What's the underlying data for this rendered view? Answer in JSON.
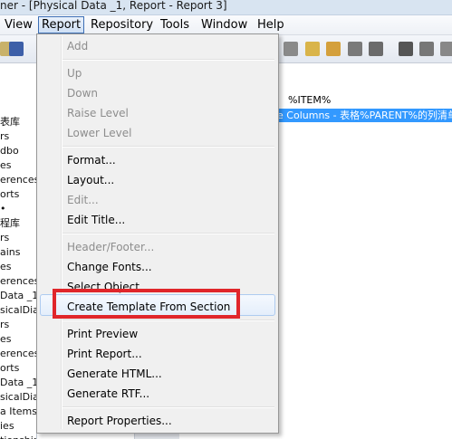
{
  "window": {
    "title": "ner - [Physical Data _1, Report - Report 3]"
  },
  "menubar": {
    "items": [
      "View",
      "Report",
      "Repository",
      "Tools",
      "Window",
      "Help"
    ]
  },
  "tree": {
    "items": [
      "表库",
      "rs",
      "dbo",
      "es",
      "erences",
      "orts",
      "•",
      "程库",
      "rs",
      "ains",
      "es",
      "erences",
      "Data _1",
      "sicalDiag",
      "rs",
      "es",
      "erences",
      "orts",
      "Data _1",
      "sicalDiag",
      "a Items",
      "ies",
      "tionships"
    ]
  },
  "doc": {
    "item": "%ITEM%",
    "selected": "ble Columns - 表格%PARENT%的列清单"
  },
  "dropdown": {
    "items": [
      {
        "label": "Add",
        "disabled": true
      },
      {
        "label": "Up",
        "disabled": true
      },
      {
        "label": "Down",
        "disabled": true
      },
      {
        "label": "Raise Level",
        "disabled": true
      },
      {
        "label": "Lower Level",
        "disabled": true
      },
      {
        "label": "Format...",
        "disabled": false
      },
      {
        "label": "Layout...",
        "disabled": false
      },
      {
        "label": "Edit...",
        "disabled": true
      },
      {
        "label": "Edit Title...",
        "disabled": false
      },
      {
        "label": "Header/Footer...",
        "disabled": true
      },
      {
        "label": "Change Fonts...",
        "disabled": false
      },
      {
        "label": "Select Object...",
        "disabled": false
      },
      {
        "label": "Create Template From Section",
        "disabled": false
      },
      {
        "label": "Print Preview",
        "disabled": false
      },
      {
        "label": "Print Report...",
        "disabled": false
      },
      {
        "label": "Generate HTML...",
        "disabled": false
      },
      {
        "label": "Generate RTF...",
        "disabled": false
      },
      {
        "label": "Report Properties...",
        "disabled": false
      }
    ]
  }
}
